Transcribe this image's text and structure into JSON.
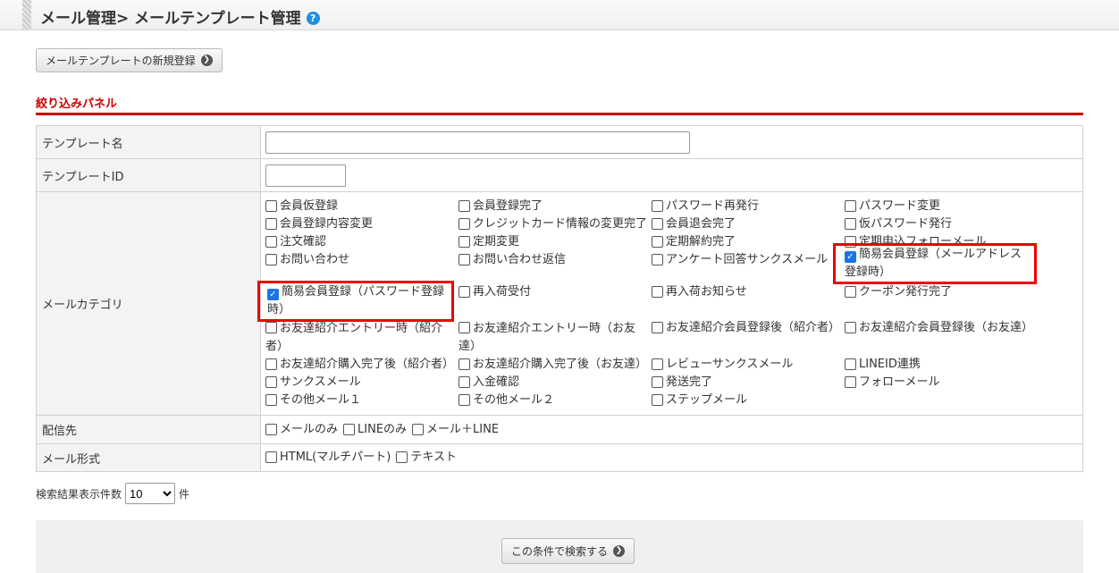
{
  "header": {
    "title": "メール管理> メールテンプレート管理",
    "help": "?"
  },
  "new_button": "メールテンプレートの新規登録",
  "panel_title": "絞り込みパネル",
  "fields": {
    "template_name": {
      "label": "テンプレート名",
      "value": ""
    },
    "template_id": {
      "label": "テンプレートID",
      "value": ""
    },
    "category": {
      "label": "メールカテゴリ",
      "items": [
        {
          "label": "会員仮登録",
          "checked": false
        },
        {
          "label": "会員登録完了",
          "checked": false
        },
        {
          "label": "パスワード再発行",
          "checked": false
        },
        {
          "label": "パスワード変更",
          "checked": false
        },
        {
          "label": "会員登録内容変更",
          "checked": false
        },
        {
          "label": "クレジットカード情報の変更完了",
          "checked": false
        },
        {
          "label": "会員退会完了",
          "checked": false
        },
        {
          "label": "仮パスワード発行",
          "checked": false
        },
        {
          "label": "注文確認",
          "checked": false
        },
        {
          "label": "定期変更",
          "checked": false
        },
        {
          "label": "定期解約完了",
          "checked": false
        },
        {
          "label": "定期申込フォローメール",
          "checked": false
        },
        {
          "label": "お問い合わせ",
          "checked": false
        },
        {
          "label": "お問い合わせ返信",
          "checked": false
        },
        {
          "label": "アンケート回答サンクスメール",
          "checked": false
        },
        {
          "label": "簡易会員登録（メールアドレス登録時）",
          "checked": true
        },
        {
          "label": "簡易会員登録（パスワード登録時）",
          "checked": true
        },
        {
          "label": "再入荷受付",
          "checked": false
        },
        {
          "label": "再入荷お知らせ",
          "checked": false
        },
        {
          "label": "クーポン発行完了",
          "checked": false
        },
        {
          "label": "お友達紹介エントリー時（紹介者）",
          "checked": false
        },
        {
          "label": "お友達紹介エントリー時（お友達）",
          "checked": false
        },
        {
          "label": "お友達紹介会員登録後（紹介者）",
          "checked": false
        },
        {
          "label": "お友達紹介会員登録後（お友達）",
          "checked": false
        },
        {
          "label": "お友達紹介購入完了後（紹介者）",
          "checked": false
        },
        {
          "label": "お友達紹介購入完了後（お友達）",
          "checked": false
        },
        {
          "label": "レビューサンクスメール",
          "checked": false
        },
        {
          "label": "LINEID連携",
          "checked": false
        },
        {
          "label": "サンクスメール",
          "checked": false
        },
        {
          "label": "入金確認",
          "checked": false
        },
        {
          "label": "発送完了",
          "checked": false
        },
        {
          "label": "フォローメール",
          "checked": false
        },
        {
          "label": "その他メール１",
          "checked": false
        },
        {
          "label": "その他メール２",
          "checked": false
        },
        {
          "label": "ステップメール",
          "checked": false
        }
      ]
    },
    "destination": {
      "label": "配信先",
      "items": [
        {
          "label": "メールのみ",
          "checked": false
        },
        {
          "label": "LINEのみ",
          "checked": false
        },
        {
          "label": "メール＋LINE",
          "checked": false
        }
      ]
    },
    "format": {
      "label": "メール形式",
      "items": [
        {
          "label": "HTML(マルチパート)",
          "checked": false
        },
        {
          "label": "テキスト",
          "checked": false
        }
      ]
    }
  },
  "results_count": {
    "label": "検索結果表示件数",
    "value": "10",
    "unit": "件"
  },
  "search_button": "この条件で検索する"
}
